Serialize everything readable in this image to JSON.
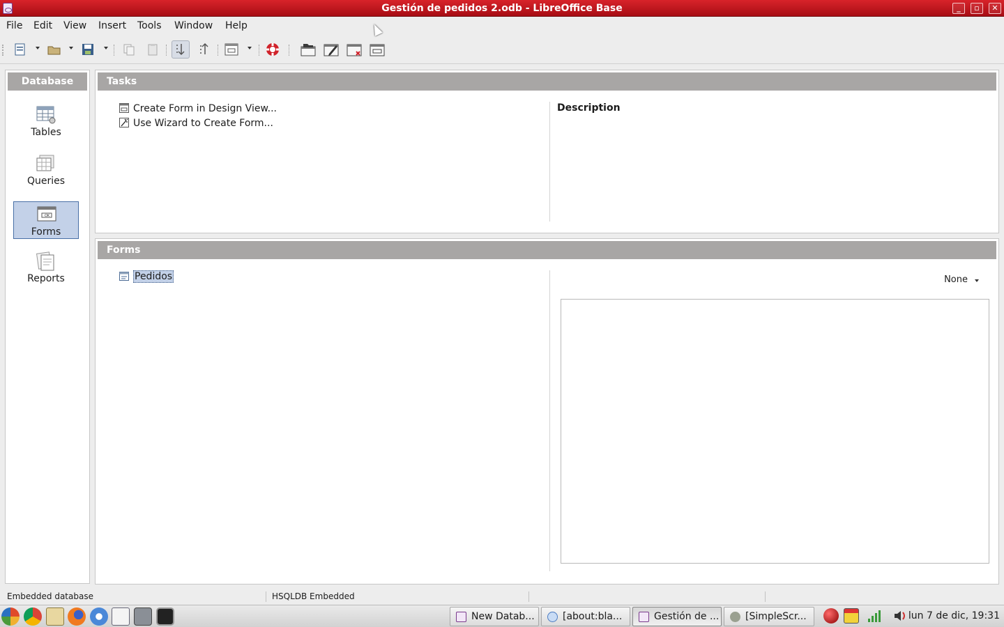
{
  "window": {
    "title": "Gestión de pedidos 2.odb - LibreOffice Base",
    "controls": [
      "_",
      "▫",
      "✕"
    ]
  },
  "menubar": [
    "File",
    "Edit",
    "View",
    "Insert",
    "Tools",
    "Window",
    "Help"
  ],
  "toolbar": {
    "icons": [
      "new-document-icon",
      "open-folder-icon",
      "save-icon",
      "copy-icon",
      "paste-icon",
      "sort-ascending-icon",
      "sort-descending-icon",
      "form-icon",
      "help-lifebuoy-icon",
      "open-database-object-icon",
      "edit-icon",
      "delete-icon",
      "rename-icon"
    ]
  },
  "left_panel": {
    "header": "Database",
    "categories": [
      {
        "label": "Tables",
        "icon": "tables-icon"
      },
      {
        "label": "Queries",
        "icon": "queries-icon"
      },
      {
        "label": "Forms",
        "icon": "forms-icon",
        "selected": true
      },
      {
        "label": "Reports",
        "icon": "reports-icon"
      }
    ]
  },
  "tasks": {
    "header": "Tasks",
    "items": [
      {
        "label": "Create Form in Design View...",
        "icon": "form-design-icon"
      },
      {
        "label": "Use Wizard to Create Form...",
        "icon": "wizard-icon"
      }
    ],
    "description_title": "Description"
  },
  "forms": {
    "header": "Forms",
    "items": [
      {
        "label": "Pedidos",
        "selected": true
      }
    ],
    "preview_mode": "None"
  },
  "statusbar": {
    "left": "Embedded database",
    "middle": "HSQLDB Embedded"
  },
  "taskbar": {
    "windows": [
      {
        "label": "New Datab..."
      },
      {
        "label": "[about:bla..."
      },
      {
        "label": "Gestión de ...",
        "active": true
      },
      {
        "label": "[SimpleScr..."
      }
    ],
    "clock": "lun  7 de dic, 19:31"
  },
  "colors": {
    "titlebar": "#c4161e",
    "panel_header": "#a8a6a5",
    "selection": "#c3d1e8"
  }
}
